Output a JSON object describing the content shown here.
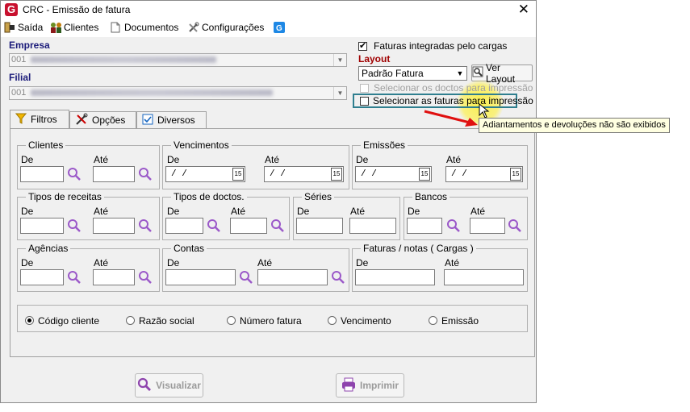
{
  "window": {
    "title": "CRC - Emissão de fatura",
    "logo_letter": "G",
    "close": "✕"
  },
  "menu": [
    {
      "label": "Saída",
      "icon": "exit-icon"
    },
    {
      "label": "Clientes",
      "icon": "people-icon"
    },
    {
      "label": "Documentos",
      "icon": "document-icon"
    },
    {
      "label": "Configurações",
      "icon": "tools-icon"
    },
    {
      "label": "",
      "icon": "app-logo-icon"
    }
  ],
  "empresa": {
    "label": "Empresa",
    "value": "001"
  },
  "filial": {
    "label": "Filial",
    "value": "001"
  },
  "options": {
    "faturas_integradas": {
      "label": "Faturas integradas pelo cargas",
      "checked": true
    },
    "selecionar_doctos": {
      "label": "Selecionar os doctos para impressão",
      "checked": false,
      "disabled": true
    },
    "selecionar_faturas": {
      "label": "Selecionar as faturas para impressão",
      "checked": false
    }
  },
  "layout": {
    "label": "Layout",
    "value": "Padrão Fatura",
    "ver_layout": "Ver Layout"
  },
  "tooltip": "Adiantamentos e devoluções não são exibidos",
  "tabs": [
    {
      "label": "Filtros",
      "icon": "funnel-icon",
      "active": true
    },
    {
      "label": "Opções",
      "icon": "tools-icon",
      "active": false
    },
    {
      "label": "Diversos",
      "icon": "checkbox-icon",
      "active": false
    }
  ],
  "filters": {
    "de": "De",
    "ate": "Até",
    "date_placeholder": "/ /",
    "cal_label": "15",
    "clientes": "Clientes",
    "vencimentos": "Vencimentos",
    "emissoes": "Emissões",
    "tipos_receitas": "Tipos de receitas",
    "tipos_doctos": "Tipos de doctos.",
    "series": "Séries",
    "bancos": "Bancos",
    "agencias": "Agências",
    "contas": "Contas",
    "faturas_notas": "Faturas / notas ( Cargas )"
  },
  "sort": {
    "options": [
      "Código cliente",
      "Razão social",
      "Número fatura",
      "Vencimento",
      "Emissão"
    ],
    "selected": "Código cliente"
  },
  "buttons": {
    "visualizar": "Visualizar",
    "imprimir": "Imprimir"
  },
  "colors": {
    "accent_red": "#a00000",
    "magnifier": "#9b59c9",
    "highlight": "#2f7f8f"
  }
}
